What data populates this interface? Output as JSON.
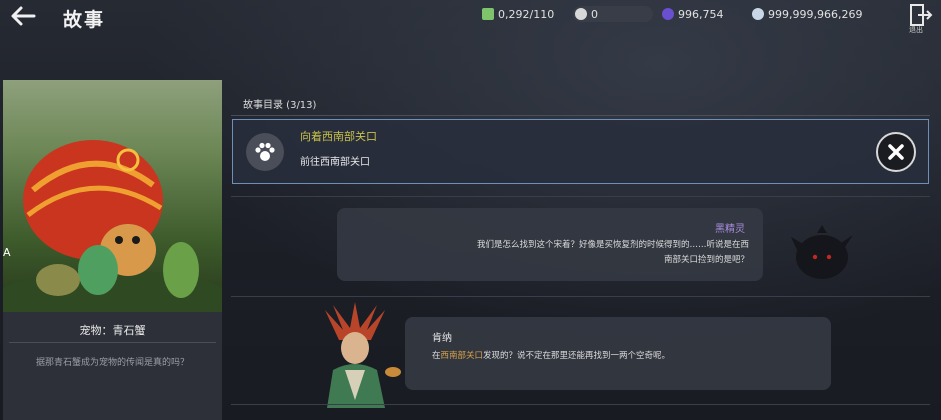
{
  "header": {
    "title": "故事",
    "exit_label": "退出"
  },
  "resources": [
    {
      "icon": "energy-icon",
      "value": "0,292/110"
    },
    {
      "icon": "silver-icon",
      "value": "0"
    },
    {
      "icon": "pearl-icon",
      "value": "996,754"
    },
    {
      "icon": "coin-icon",
      "value": "999,999,966,269"
    }
  ],
  "pet": {
    "name": "宠物：青石蟹",
    "description": "据那青石蟹成为宠物的传闻是真的吗？",
    "side_letter": "A"
  },
  "catalog": {
    "label": "故事目录 (3/13)"
  },
  "quest": {
    "title": "向着西南部关口",
    "subtitle": "前往西南部关口"
  },
  "dialogues": [
    {
      "speaker": "黑精灵",
      "line1": "我们是怎么找到这个宋着？好像是买恢复剂的时候得到的……听说是在西",
      "line2": "南部关口捡到的是吧？"
    },
    {
      "speaker": "肯纳",
      "text_before": "在",
      "highlight": "西南部关口",
      "text_after": "发现的？说不定在那里还能再找到一两个空奇呢。"
    }
  ],
  "colors": {
    "quest_title": "#c9c14a",
    "speaker_purple": "#a98ee0",
    "highlight": "#d8a24a",
    "border": "#6f8fb8"
  }
}
